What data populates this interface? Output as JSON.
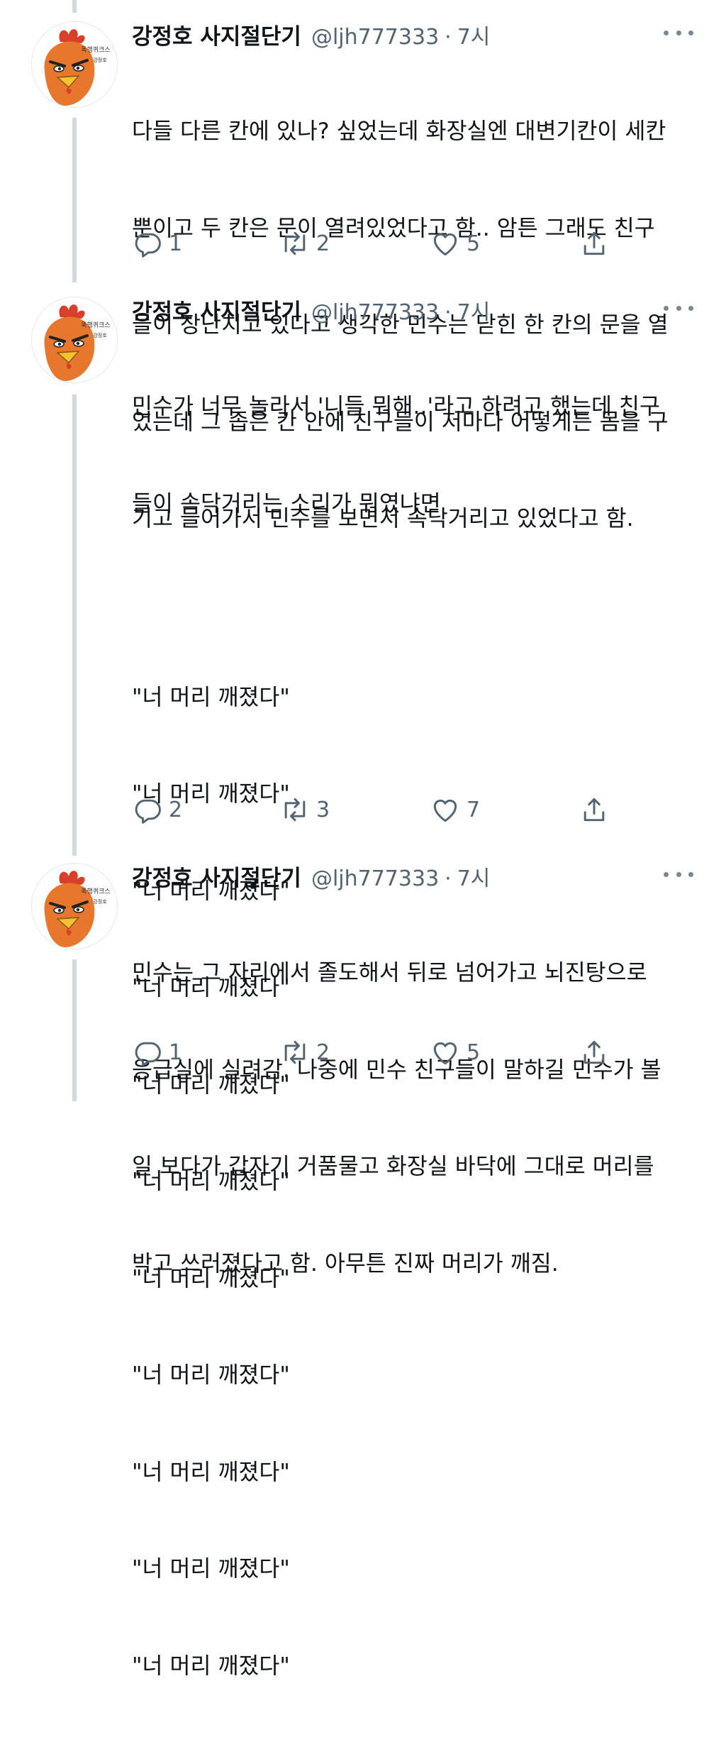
{
  "tweets": [
    {
      "author_name": "강정호 사지절단기",
      "handle": "@ljh777333",
      "time": "7시",
      "lines": [
        "다들 다른 칸에 있나? 싶었는데 화장실엔 대변기칸이 세칸",
        "뿐이고 두 칸은 문이 열려있었다고 함.. 암튼 그래도 친구",
        "들이 장난치고 있다고 생각한 민수는 닫힌 한 칸의 문을 열",
        "었는데 그 좁은 칸 안에 친구들이 저마다 어떻게든 몸을 구",
        "기고 들어가서 민수를 보면서 속닥거리고 있었다고 함."
      ],
      "reply_count": "1",
      "retweet_count": "2",
      "like_count": "5"
    },
    {
      "author_name": "강정호 사지절단기",
      "handle": "@ljh777333",
      "time": "7시",
      "lines": [
        "민수가 너무 놀라서 '니들 뭐해..'라고 하려고 했는데 친구",
        "들이 속닥거리는 소리가 뭐였냐면",
        "",
        "\"너 머리 깨졌다\"",
        "\"너 머리 깨졌다\"",
        "\"너 머리 깨졌다\"",
        "\"너 머리 깨졌다\"",
        "\"너 머리 깨졌다\"",
        "\"너 머리 깨졌다\"",
        "\"너 머리 깨졌다\"",
        "\"너 머리 깨졌다\"",
        "\"너 머리 깨졌다\"",
        "\"너 머리 깨졌다\"",
        "\"너 머리 깨졌다\""
      ],
      "reply_count": "2",
      "retweet_count": "3",
      "like_count": "7"
    },
    {
      "author_name": "강정호 사지절단기",
      "handle": "@ljh777333",
      "time": "7시",
      "lines": [
        "민수는 그 자리에서 졸도해서 뒤로 넘어가고 뇌진탕으로",
        "응급실에 실려감. 나중에 민수 친구들이 말하길 민수가 볼",
        "일 보다가 갑자기 거품물고 화장실 바닥에 그대로 머리를",
        "박고 쓰러졌다고 함. 아무튼 진짜 머리가 깨짐."
      ],
      "reply_count": "1",
      "retweet_count": "2",
      "like_count": "5"
    }
  ],
  "avatar_caption_lines": [
    "폭행퀴크스",
    "강정호"
  ],
  "icons": {
    "avatar": "rooster-avatar",
    "reply": "reply-icon",
    "retweet": "retweet-icon",
    "like": "heart-icon",
    "share": "share-icon",
    "more": "more-icon"
  },
  "colors": {
    "text": "#0f1419",
    "secondary": "#536471",
    "thread_line": "#cfd9de",
    "avatar_orange": "#e8772e"
  }
}
